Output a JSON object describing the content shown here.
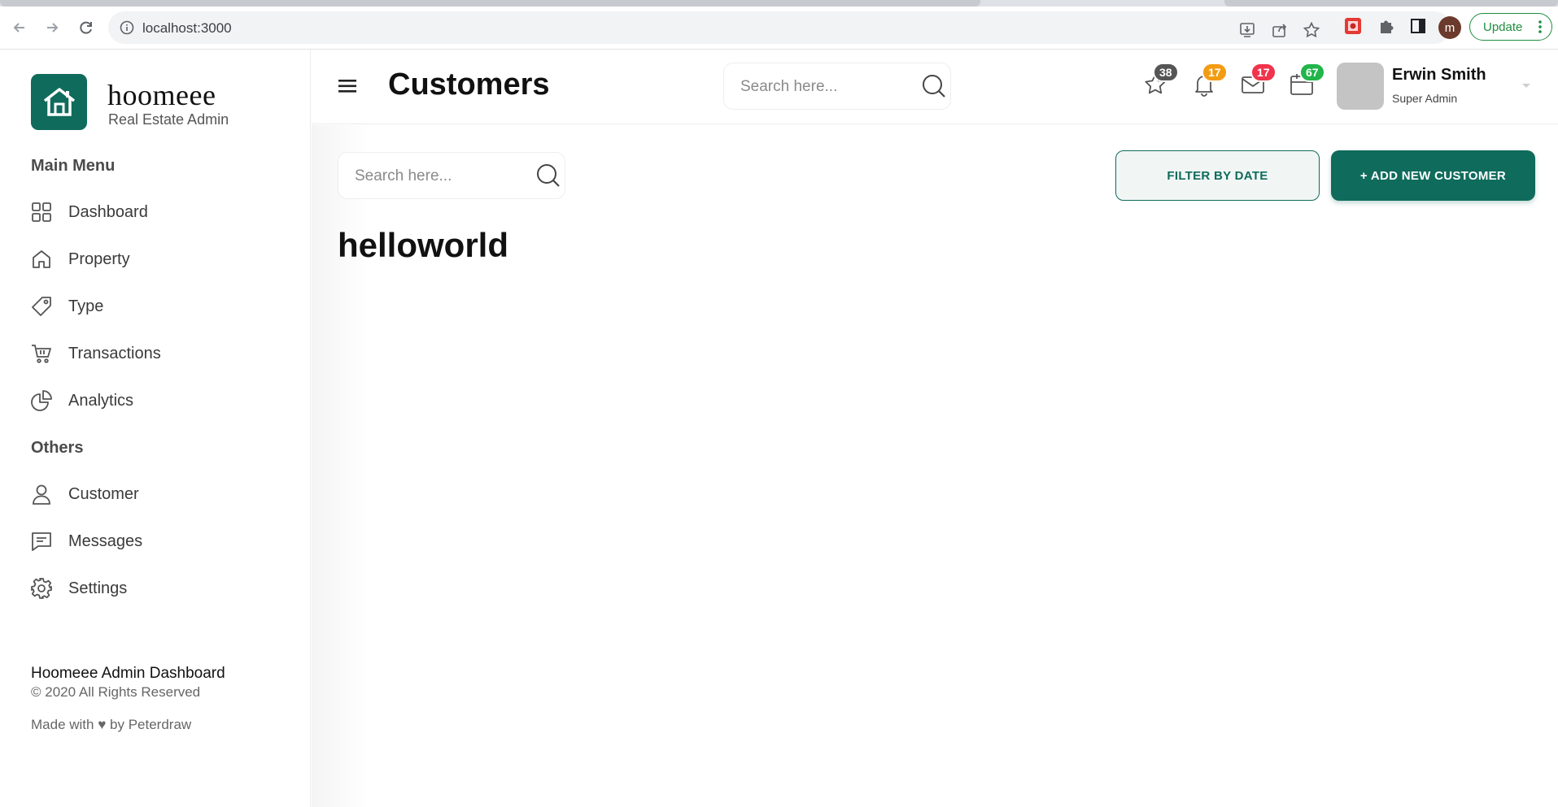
{
  "browser": {
    "url": "localhost:3000",
    "update_label": "Update",
    "profile_initial": "m"
  },
  "brand": {
    "name": "hoomeee",
    "subtitle": "Real Estate Admin",
    "accent": "#0f6b5c"
  },
  "sidebar": {
    "main_heading": "Main Menu",
    "main_items": [
      {
        "label": "Dashboard",
        "icon": "grid-icon"
      },
      {
        "label": "Property",
        "icon": "home-icon"
      },
      {
        "label": "Type",
        "icon": "tag-icon"
      },
      {
        "label": "Transactions",
        "icon": "cart-icon"
      },
      {
        "label": "Analytics",
        "icon": "pie-chart-icon"
      }
    ],
    "others_heading": "Others",
    "other_items": [
      {
        "label": "Customer",
        "icon": "user-icon"
      },
      {
        "label": "Messages",
        "icon": "message-icon"
      },
      {
        "label": "Settings",
        "icon": "gear-icon"
      }
    ],
    "footer": {
      "title": "Hoomeee Admin Dashboard",
      "copyright": "© 2020 All Rights Reserved",
      "made_with": "Made with ♥ by Peterdraw"
    }
  },
  "header": {
    "title": "Customers",
    "search_placeholder": "Search here...",
    "notifications": [
      {
        "icon": "star-icon",
        "count": "38",
        "color": "#555555"
      },
      {
        "icon": "bell-icon",
        "count": "17",
        "color": "#f39c12"
      },
      {
        "icon": "mail-icon",
        "count": "17",
        "color": "#f1334b"
      },
      {
        "icon": "calendar-icon",
        "count": "67",
        "color": "#21b54a"
      }
    ],
    "user": {
      "name": "Erwin Smith",
      "role": "Super Admin"
    }
  },
  "main": {
    "search_placeholder": "Search here...",
    "filter_label": "FILTER BY DATE",
    "add_label": "+ ADD NEW CUSTOMER",
    "heading": "helloworld"
  }
}
